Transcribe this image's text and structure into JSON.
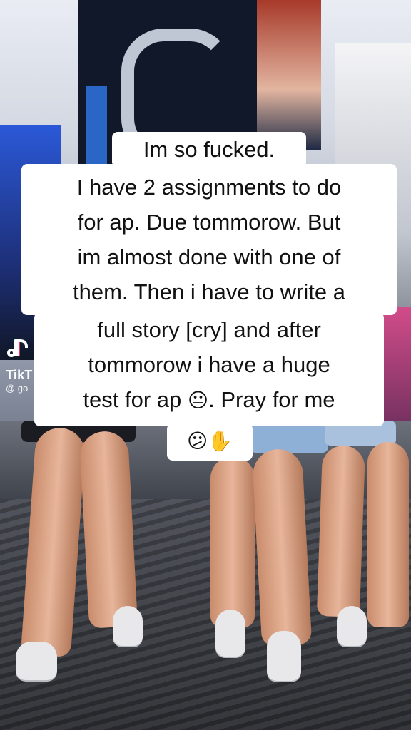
{
  "watermark": {
    "brand": "TikT",
    "user": "@ go"
  },
  "caption": {
    "line1": "Im so fucked.",
    "line2": "I have 2 assignments to do",
    "line3": "for ap. Due tommorow. But",
    "line4": "im almost done with one of",
    "line5": "them. Then i have to write a",
    "line6": "full story [cry] and after",
    "line7": "tommorow i have a huge",
    "line8_prefix": "test for ap ",
    "line8_emoji": "😐",
    "line8_suffix": ". Pray for me",
    "line9_emoji": "😕✋"
  }
}
